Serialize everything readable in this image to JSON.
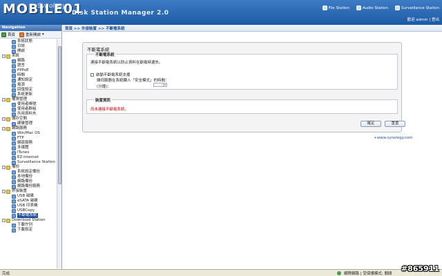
{
  "header": {
    "logo": "MOBILE01",
    "logo_sub": "Synology",
    "app_title": "Disk Station Manager 2.0",
    "links": [
      "File Station",
      "Audio Station",
      "Surveillance Station"
    ],
    "user_bar": "歡迎 admin | 登出"
  },
  "sidebar": {
    "title": "Navigation",
    "toolbar": {
      "home": "首頁",
      "quick": "重新開啟"
    },
    "items": [
      {
        "label": "系統狀態",
        "level": 1,
        "type": "leaf"
      },
      {
        "label": "日誌",
        "level": 1,
        "type": "leaf"
      },
      {
        "label": "開啟",
        "level": 1,
        "type": "leaf"
      },
      {
        "label": "系統",
        "level": 0,
        "type": "folder"
      },
      {
        "label": "網路",
        "level": 1,
        "type": "leaf"
      },
      {
        "label": "語言",
        "level": 1,
        "type": "leaf"
      },
      {
        "label": "PPPoE",
        "level": 1,
        "type": "leaf"
      },
      {
        "label": "時間",
        "level": 1,
        "type": "leaf"
      },
      {
        "label": "通知設定",
        "level": 1,
        "type": "leaf"
      },
      {
        "label": "電源",
        "level": 1,
        "type": "leaf"
      },
      {
        "label": "回復設定",
        "level": 1,
        "type": "leaf"
      },
      {
        "label": "系統更新",
        "level": 1,
        "type": "leaf"
      },
      {
        "label": "權限管理",
        "level": 0,
        "type": "folder"
      },
      {
        "label": "使用者帳號",
        "level": 1,
        "type": "leaf"
      },
      {
        "label": "使用者群組",
        "level": 1,
        "type": "leaf"
      },
      {
        "label": "共用資料夾",
        "level": 1,
        "type": "leaf"
      },
      {
        "label": "儲存空間",
        "level": 0,
        "type": "folder"
      },
      {
        "label": "硬碟管理",
        "level": 1,
        "type": "leaf"
      },
      {
        "label": "網路服務",
        "level": 0,
        "type": "folder"
      },
      {
        "label": "Win/Mac OS",
        "level": 1,
        "type": "leaf"
      },
      {
        "label": "FTP",
        "level": 1,
        "type": "leaf"
      },
      {
        "label": "網頁服務",
        "level": 1,
        "type": "leaf"
      },
      {
        "label": "多媒體",
        "level": 1,
        "type": "leaf"
      },
      {
        "label": "iTunes",
        "level": 1,
        "type": "leaf"
      },
      {
        "label": "EZ-Internet",
        "level": 1,
        "type": "leaf"
      },
      {
        "label": "Surveillance Station",
        "level": 1,
        "type": "leaf"
      },
      {
        "label": "備份",
        "level": 0,
        "type": "folder"
      },
      {
        "label": "系統設定備份",
        "level": 1,
        "type": "leaf"
      },
      {
        "label": "本地備份",
        "level": 1,
        "type": "leaf"
      },
      {
        "label": "網路備份",
        "level": 1,
        "type": "leaf"
      },
      {
        "label": "網路備份服務",
        "level": 1,
        "type": "leaf"
      },
      {
        "label": "外接裝置",
        "level": 0,
        "type": "folder"
      },
      {
        "label": "USB 磁碟",
        "level": 1,
        "type": "leaf"
      },
      {
        "label": "eSATA 磁碟",
        "level": 1,
        "type": "leaf"
      },
      {
        "label": "USB 印表機",
        "level": 1,
        "type": "leaf"
      },
      {
        "label": "USBCopy",
        "level": 1,
        "type": "leaf"
      },
      {
        "label": "不斷電系統",
        "level": 1,
        "type": "leaf",
        "selected": true
      },
      {
        "label": "Download Station",
        "level": 0,
        "type": "folder"
      },
      {
        "label": "下載佇列",
        "level": 1,
        "type": "leaf"
      },
      {
        "label": "下載設定",
        "level": 1,
        "type": "leaf"
      }
    ]
  },
  "main": {
    "breadcrumb": "首頁 >> 外接裝置 >> 不斷電系統",
    "panel_title": "不斷電系統",
    "ups_section": {
      "legend": "不斷電系統",
      "description": "連接不斷電系統以防止資料在斷電時遺失。",
      "checkbox_label": "啟動不斷電系統支援",
      "sub_text": "讓伺服器在系統轉入「安全模式」的時間：",
      "select_label": "(分鐘)："
    },
    "device_section": {
      "legend": "裝置資訊",
      "status": "尚未連接不斷電系統。"
    },
    "ok_button": "確定",
    "reset_button": "重置",
    "site_link": "+www.synology.com"
  },
  "statusbar": {
    "left": "完成",
    "zone": "網際網路 | 受保護模式: 關閉"
  },
  "watermark": "#865911"
}
